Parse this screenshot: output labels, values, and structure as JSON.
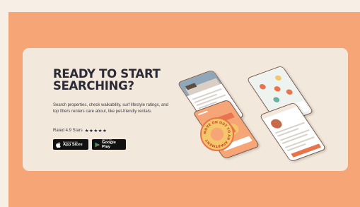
{
  "promo": {
    "headline_line1": "READY TO START",
    "headline_line2": "SEARCHING?",
    "description": "Search properties, check walkability, surf lifestyle ratings, and top filters renters care about, like pet-friendly rentals.",
    "rating_label": "Rated 4.9 Stars",
    "stars": "★★★★★"
  },
  "stores": {
    "apple_small": "Download on the",
    "apple_label": "App Store",
    "google_small": "GET IT ON",
    "google_label": "Google Play"
  },
  "badge": {
    "text": "MOVE ON OUT TO AN APARTMENT"
  },
  "colors": {
    "band": "#f6a676",
    "card": "#f3e8dc",
    "headline": "#2b2b38",
    "badge_fill": "#f3c76a",
    "badge_ring": "#e8734d"
  },
  "icons": [
    "apple-icon",
    "google-play-icon"
  ]
}
